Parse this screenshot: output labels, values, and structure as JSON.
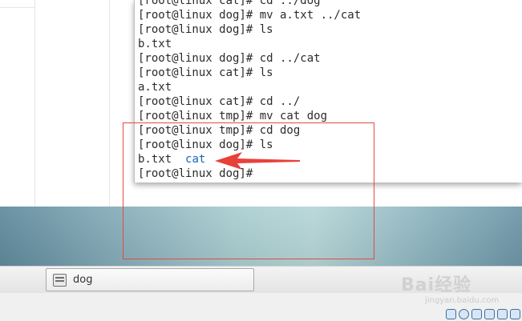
{
  "terminal": {
    "lines": [
      {
        "prompt": "[root@linux cat]# ",
        "cmd": "cd ../dog"
      },
      {
        "prompt": "[root@linux dog]# ",
        "cmd": "mv a.txt ../cat"
      },
      {
        "prompt": "[root@linux dog]# ",
        "cmd": "ls"
      },
      {
        "output": "b.txt"
      },
      {
        "prompt": "[root@linux dog]# ",
        "cmd": "cd ../cat"
      },
      {
        "prompt": "[root@linux cat]# ",
        "cmd": "ls"
      },
      {
        "output": "a.txt"
      },
      {
        "prompt": "[root@linux cat]# ",
        "cmd": "cd ../"
      },
      {
        "prompt": "[root@linux tmp]# ",
        "cmd": "mv cat dog"
      },
      {
        "prompt": "[root@linux tmp]# ",
        "cmd": "cd dog"
      },
      {
        "prompt": "[root@linux dog]# ",
        "cmd": "ls"
      },
      {
        "output_file": "b.txt  ",
        "output_dir": "cat"
      },
      {
        "prompt": "[root@linux dog]# ",
        "cmd": ""
      }
    ],
    "dir_color": "#1565c0"
  },
  "taskbar": {
    "window_label": "dog",
    "window_icon": "terminal-window-icon"
  },
  "watermark": {
    "brand": "Bai经验",
    "url": "jingyan.baidu.com"
  },
  "tray": {
    "icons": [
      "network-icon",
      "clock-icon",
      "display-icon",
      "usb-icon",
      "monitor-icon",
      "chat-icon"
    ]
  },
  "annotation": {
    "color": "#e14b45"
  }
}
